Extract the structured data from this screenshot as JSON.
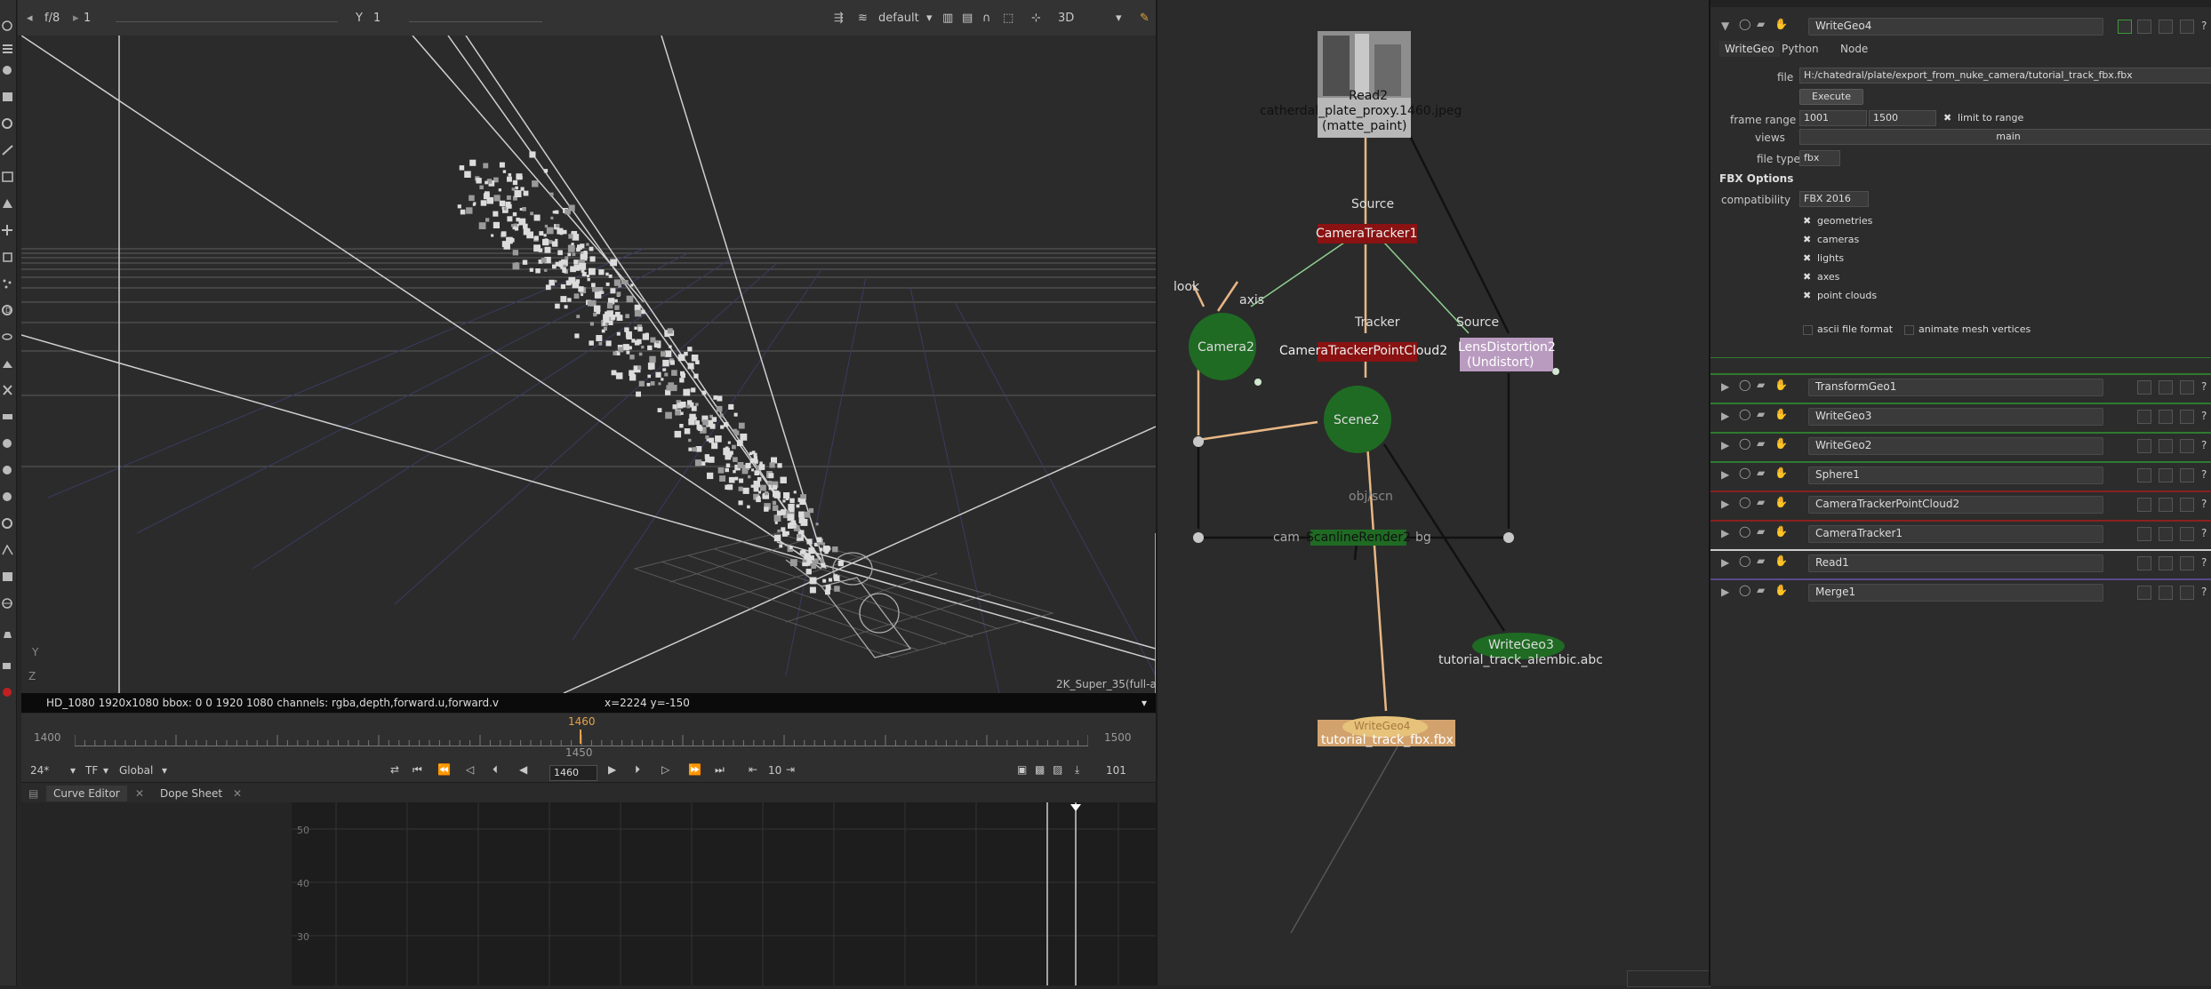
{
  "viewer": {
    "frame_stop": "f/8",
    "frame_1": "1",
    "y_label": "Y",
    "y_value": "1",
    "lut": "default",
    "mode": "3D",
    "info_format": "HD_1080 1920x1080  bbox: 0 0 1920 1080 channels: rgba,depth,forward.u,forward.v",
    "info_coords": "x=2224 y=-150",
    "format_label": "2K_Super_35(full-a",
    "axis_y": "Y",
    "axis_z": "Z"
  },
  "timeline": {
    "start": "1400",
    "end": "1500",
    "tick_1450": "1450",
    "current_marker": "1460",
    "fps": "24*",
    "tf": "TF",
    "global": "Global",
    "current_frame": "1460",
    "increment": "10",
    "frame_right": "101"
  },
  "tabs": {
    "curve_editor": "Curve Editor",
    "dope_sheet": "Dope Sheet"
  },
  "curve_axis": [
    "50",
    "40",
    "30"
  ],
  "nodes": {
    "read2": "Read2",
    "read2_file": "catherdal_plate_proxy.1460.jpeg",
    "read2_sub": "(matte_paint)",
    "source_label": "Source",
    "camera_tracker": "CameraTracker1",
    "look_label": "look",
    "axis_label": "axis",
    "tracker_label": "Tracker",
    "source2_label": "Source",
    "camera2": "Camera2",
    "pointcloud": "CameraTrackerPointCloud2",
    "lensdist": "LensDistortion2",
    "lensdist_sub": "(Undistort)",
    "scene2": "Scene2",
    "objscn_label": "obj/scn",
    "cam_label": "cam",
    "scanline": "ScanlineRender2",
    "bg_label": "bg",
    "writegeo3": "WriteGeo3",
    "writegeo3_file": "tutorial_track_alembic.abc",
    "writegeo4": "WriteGeo4",
    "writegeo4_file": "tutorial_track_fbx.fbx"
  },
  "props": {
    "node_name": "WriteGeo4",
    "tabs": [
      "WriteGeo",
      "Python",
      "Node"
    ],
    "file_label": "file",
    "file_value": "H:/chatedral/plate/export_from_nuke_camera/tutorial_track_fbx.fbx",
    "execute": "Execute",
    "frame_range_label": "frame range",
    "range_start": "1001",
    "range_end": "1500",
    "limit_to_range": "limit to range",
    "views_label": "views",
    "views_value": "main",
    "file_type_label": "file type",
    "file_type_value": "fbx",
    "fbx_options": "FBX Options",
    "compat_label": "compatibility",
    "compat_value": "FBX 2016",
    "geometries": "geometries",
    "cameras": "cameras",
    "lights": "lights",
    "axes": "axes",
    "point_clouds": "point clouds",
    "ascii": "ascii file format",
    "animate_mesh": "animate mesh vertices",
    "other_nodes": [
      "TransformGeo1",
      "WriteGeo3",
      "WriteGeo2",
      "Sphere1",
      "CameraTrackerPointCloud2",
      "CameraTracker1",
      "Read1",
      "Merge1"
    ]
  },
  "colors": {
    "node_green": "#1f6b23",
    "camera_tracker_red": "#8a1212",
    "lens_purple": "#b99bc0",
    "write_orange": "#d2a26d"
  }
}
